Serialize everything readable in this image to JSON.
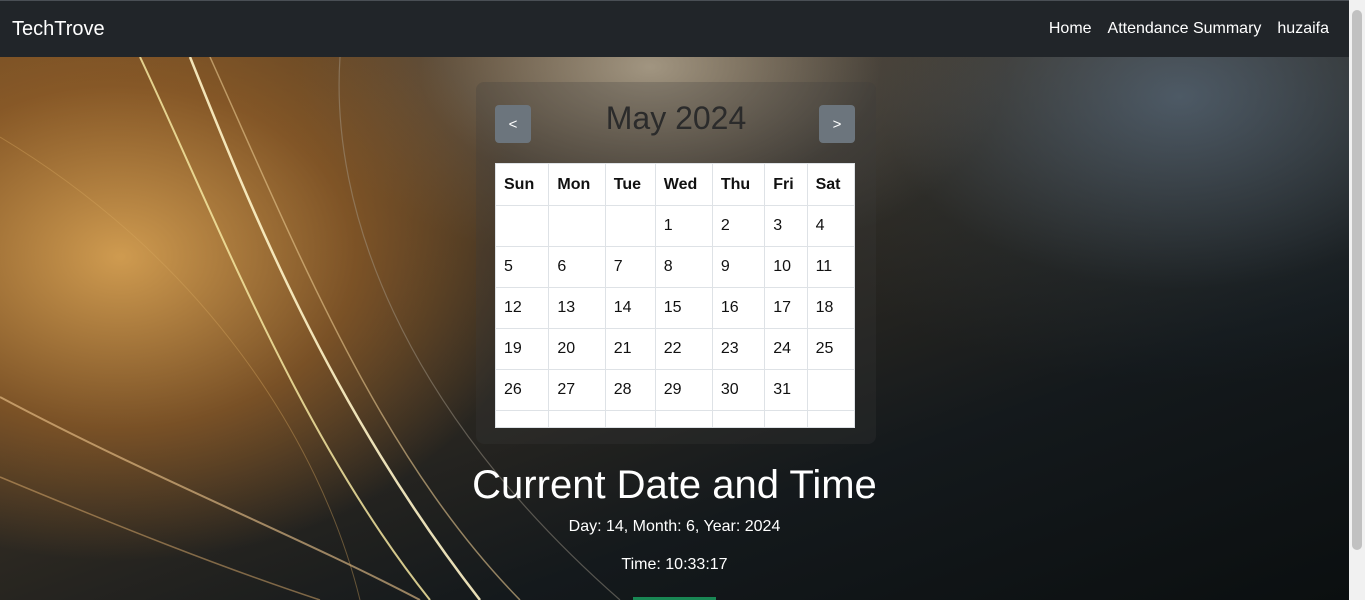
{
  "navbar": {
    "brand": "TechTrove",
    "links": [
      "Home",
      "Attendance Summary",
      "huzaifa"
    ]
  },
  "calendar": {
    "prev_label": "<",
    "next_label": ">",
    "month_title": "May 2024",
    "weekdays": [
      "Sun",
      "Mon",
      "Tue",
      "Wed",
      "Thu",
      "Fri",
      "Sat"
    ],
    "weeks": [
      [
        "",
        "",
        "",
        "1",
        "2",
        "3",
        "4"
      ],
      [
        "5",
        "6",
        "7",
        "8",
        "9",
        "10",
        "11"
      ],
      [
        "12",
        "13",
        "14",
        "15",
        "16",
        "17",
        "18"
      ],
      [
        "19",
        "20",
        "21",
        "22",
        "23",
        "24",
        "25"
      ],
      [
        "26",
        "27",
        "28",
        "29",
        "30",
        "31",
        ""
      ],
      [
        "",
        "",
        "",
        "",
        "",
        "",
        ""
      ]
    ]
  },
  "datetime": {
    "title": "Current Date and Time",
    "date_line": "Day: 14, Month: 6, Year: 2024",
    "time_line": "Time: 10:33:17"
  },
  "colors": {
    "navbar": "#212529",
    "button": "#6c757d",
    "accent": "#198754"
  }
}
